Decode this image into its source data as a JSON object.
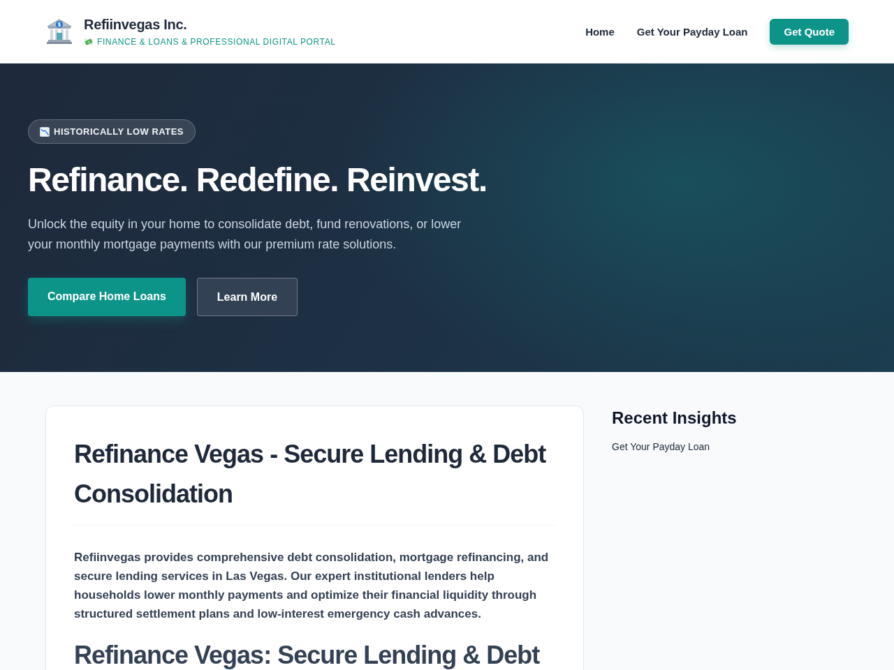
{
  "header": {
    "brand": "Refiinvegas Inc.",
    "tagline": "FINANCE & LOANS & PROFESSIONAL DIGITAL PORTAL",
    "nav": [
      "Home",
      "Get Your Payday Loan"
    ],
    "cta": "Get Quote"
  },
  "hero": {
    "badge": "HISTORICALLY LOW RATES",
    "title": "Refinance. Redefine. Reinvest.",
    "text": "Unlock the equity in your home to consolidate debt, fund renovations, or lower your monthly mortgage payments with our premium rate solutions.",
    "buttons": [
      {
        "label": "Compare Home Loans",
        "kind": "primary"
      },
      {
        "label": "Learn More",
        "kind": "secondary"
      }
    ]
  },
  "article": {
    "title": "Refinance Vegas - Secure Lending & Debt Consolidation",
    "intro": "Refiinvegas provides comprehensive debt consolidation, mortgage refinancing, and secure lending services in Las Vegas. Our expert institutional lenders help households lower monthly payments and optimize their financial liquidity through structured settlement plans and low-interest emergency cash advances.",
    "heading": "Refinance Vegas: Secure Lending & Debt"
  },
  "sidebar": {
    "title": "Recent Insights",
    "links": [
      "Get Your Payday Loan"
    ]
  }
}
